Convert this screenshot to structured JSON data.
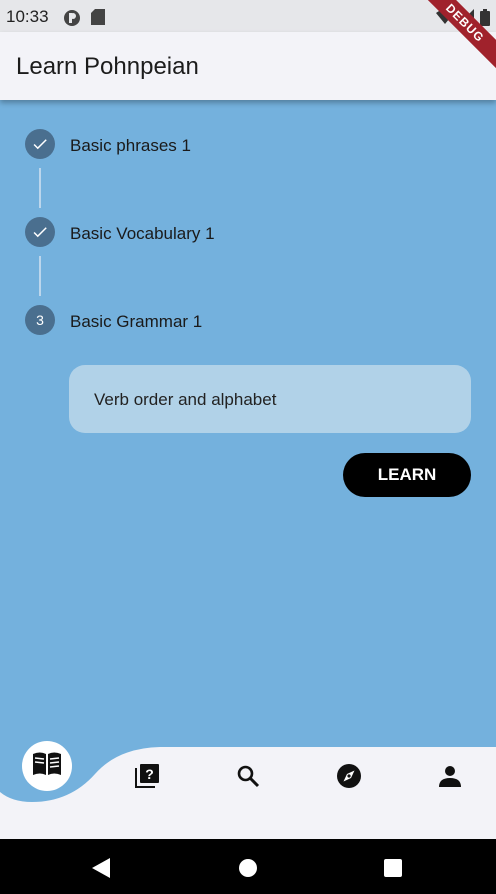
{
  "status_bar": {
    "time": "10:33"
  },
  "debug_banner": {
    "label": "DEBUG"
  },
  "app_bar": {
    "title": "Learn Pohnpeian"
  },
  "steps": [
    {
      "label": "Basic phrases 1",
      "state": "completed"
    },
    {
      "label": "Basic Vocabulary 1",
      "state": "completed"
    },
    {
      "label": "Basic Grammar 1",
      "state": "active",
      "number": "3"
    }
  ],
  "active_step": {
    "description": "Verb order and alphabet",
    "button_label": "LEARN"
  },
  "bottom_nav": {
    "items": [
      {
        "icon": "book-icon",
        "active": true
      },
      {
        "icon": "quiz-icon",
        "active": false
      },
      {
        "icon": "search-icon",
        "active": false
      },
      {
        "icon": "compass-icon",
        "active": false
      },
      {
        "icon": "person-icon",
        "active": false
      }
    ]
  },
  "colors": {
    "background": "#74b1dd",
    "step_circle": "#4a6f8f",
    "card": "#b1d2e8",
    "app_bar": "#f3f3f8",
    "button": "#000000"
  }
}
